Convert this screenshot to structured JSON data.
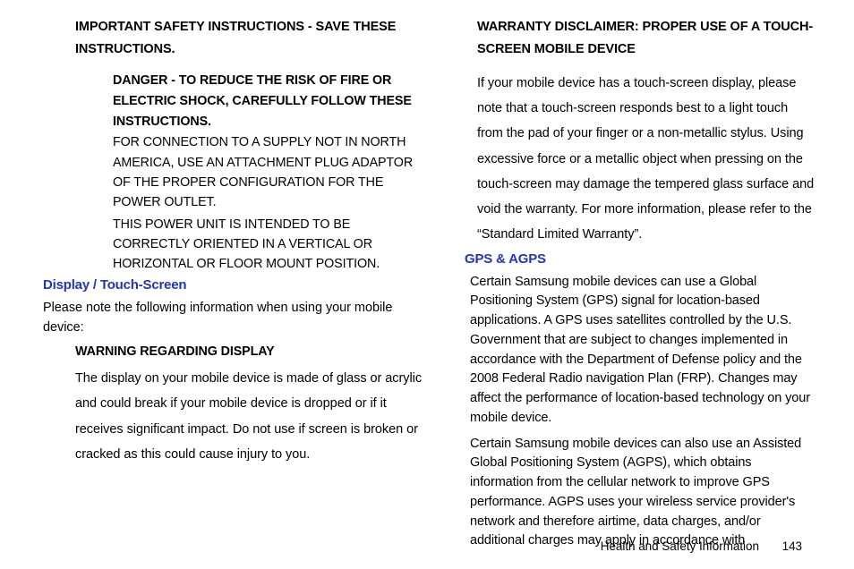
{
  "left": {
    "safetyHeading": "IMPORTANT SAFETY INSTRUCTIONS - SAVE THESE INSTRUCTIONS.",
    "dangerBold": "DANGER - TO REDUCE THE RISK OF FIRE OR ELECTRIC SHOCK, CAREFULLY FOLLOW THESE INSTRUCTIONS.",
    "para1": "FOR CONNECTION TO A SUPPLY NOT IN NORTH AMERICA, USE AN ATTACHMENT PLUG ADAPTOR OF THE PROPER CONFIGURATION FOR THE POWER OUTLET.",
    "para2": "THIS POWER UNIT IS INTENDED TO BE CORRECTLY ORIENTED IN A VERTICAL OR HORIZONTAL OR FLOOR MOUNT POSITION.",
    "displayHeading": "Display / Touch-Screen",
    "displayNote": "Please note the following information when using your mobile device:",
    "warningHeading": "WARNING REGARDING DISPLAY",
    "warningBody": "The display on your mobile device is made of glass or acrylic and could break if your mobile device is dropped or if it receives significant impact. Do not use if screen is broken or cracked as this could cause injury to you."
  },
  "right": {
    "warrantyHeading": "WARRANTY DISCLAIMER: PROPER USE OF A TOUCH-SCREEN MOBILE DEVICE",
    "warrantyBody": "If your mobile device has a touch-screen display, please note that a touch-screen responds best to a light touch from the pad of your finger or a non-metallic stylus. Using excessive force or a metallic object when pressing on the touch-screen may damage the tempered glass surface and void the warranty. For more information, please refer to the “Standard Limited Warranty”.",
    "gpsHeading": "GPS & AGPS",
    "gpsPara1": "Certain Samsung mobile devices can use a Global Positioning System (GPS) signal for location-based applications. A GPS uses satellites controlled by the U.S. Government that are subject to changes implemented in accordance with the Department of Defense policy and the 2008 Federal Radio navigation Plan (FRP). Changes may affect the performance of location-based technology on your mobile device.",
    "gpsPara2": "Certain Samsung mobile devices can also use an Assisted Global Positioning System (AGPS), which obtains information from the cellular network to improve GPS performance. AGPS uses your wireless service provider's network and therefore airtime, data charges, and/or additional charges may apply in accordance with"
  },
  "footer": {
    "section": "Health and Safety Information",
    "page": "143"
  }
}
